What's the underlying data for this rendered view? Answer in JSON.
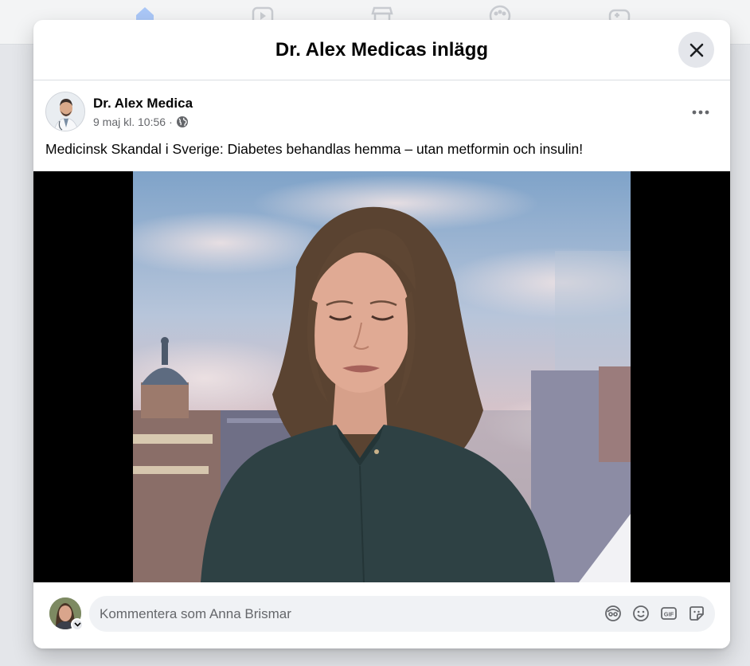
{
  "background_nav": {
    "icons": [
      "home-icon",
      "video-icon",
      "marketplace-icon",
      "groups-icon",
      "gaming-icon"
    ],
    "accent_color": "#1877f2"
  },
  "modal": {
    "title": "Dr. Alex Medicas inlägg",
    "close_icon": "close-icon"
  },
  "post": {
    "author": "Dr. Alex Medica",
    "timestamp": "9 maj kl. 10:56",
    "separator": "·",
    "audience_icon": "globe-icon",
    "more_icon": "more-options-icon",
    "text": "Medicinsk Skandal i Sverige: Diabetes behandlas hemma – utan metformin och insulin!"
  },
  "comment": {
    "placeholder": "Kommentera som Anna Brismar",
    "icons": [
      "avatar-sticker-icon",
      "emoji-icon",
      "gif-icon",
      "sticker-icon"
    ]
  }
}
